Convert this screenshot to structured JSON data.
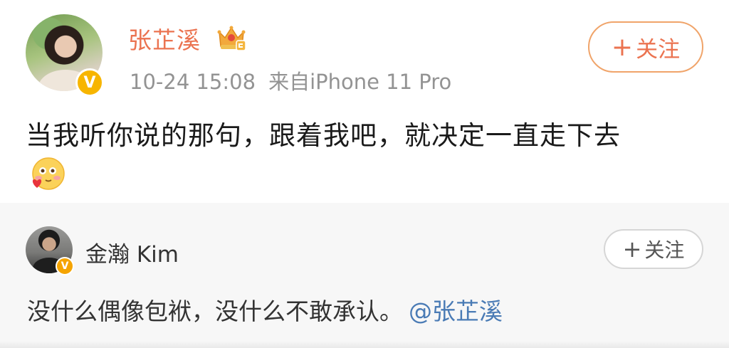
{
  "post": {
    "author": "张芷溪",
    "timestamp": "10-24 15:08",
    "source": "来自iPhone 11 Pro",
    "follow_label": "关注",
    "follow_plus": "+",
    "text": "当我听你说的那句，跟着我吧，就决定一直走下去",
    "verified_badge": "V"
  },
  "repost": {
    "author": "金瀚 Kim",
    "follow_label": "关注",
    "follow_plus": "+",
    "text": "没什么偶像包袱，没什么不敢承认。",
    "mention": "@张芷溪",
    "verified_badge": "V"
  },
  "colors": {
    "author_name": "#eb7350",
    "follow_border": "#f0a46a",
    "mention_link": "#4a7bb5",
    "verified_badge": "#f7b500",
    "repost_background": "#f7f7f7"
  },
  "icons": {
    "vip_crown": "crown-icon",
    "emoji": "shy-love-emoji",
    "verified": "verified-badge-icon"
  }
}
